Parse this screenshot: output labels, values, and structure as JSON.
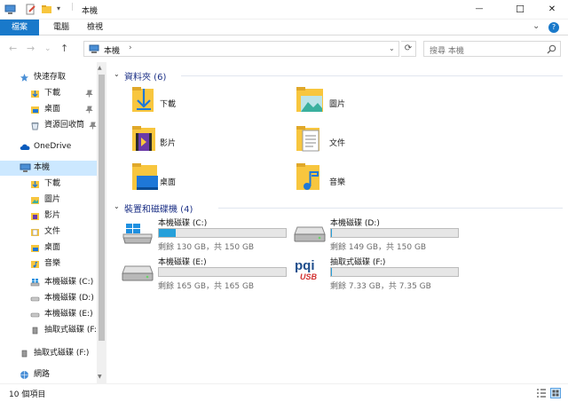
{
  "window": {
    "title": "本機",
    "minimize_glyph": "—",
    "maximize_glyph": "☐",
    "close_glyph": "✕"
  },
  "ribbon": {
    "tabs": [
      "檔案",
      "電腦",
      "檢視"
    ],
    "expand_glyph": "⌄",
    "help_glyph": "?"
  },
  "address": {
    "path": "本機",
    "separator": "›",
    "search_placeholder": "搜尋 本機",
    "nav_back": "←",
    "nav_forward": "→",
    "nav_recent": "⌄",
    "nav_up": "↑",
    "dropdown_glyph": "⌄",
    "refresh_glyph": "⟳"
  },
  "sidebar": {
    "quick_access": "快速存取",
    "quick_items": [
      "下載",
      "桌面",
      "資源回收筒"
    ],
    "onedrive": "OneDrive",
    "this_pc": "本機",
    "pc_items": [
      "下載",
      "圖片",
      "影片",
      "文件",
      "桌面",
      "音樂",
      "本機磁碟 (C:)",
      "本機磁碟 (D:)",
      "本機磁碟 (E:)",
      "抽取式磁碟 (F:)"
    ],
    "removable": "抽取式磁碟 (F:)",
    "network": "網路",
    "scroll_up": "▲",
    "scroll_down": "▼"
  },
  "folders_group": {
    "title": "資料夾 (6)",
    "chevron": "⌄",
    "items": [
      "下載",
      "圖片",
      "影片",
      "文件",
      "桌面",
      "音樂"
    ]
  },
  "drives_group": {
    "title": "裝置和磁碟機 (4)",
    "chevron": "⌄",
    "drives": [
      {
        "name": "本機磁碟 (C:)",
        "free": "剩餘 130 GB，共 150 GB",
        "used_fraction": 0.133
      },
      {
        "name": "本機磁碟 (D:)",
        "free": "剩餘 149 GB，共 150 GB",
        "used_fraction": 0.007
      },
      {
        "name": "本機磁碟 (E:)",
        "free": "剩餘 165 GB，共 165 GB",
        "used_fraction": 0
      },
      {
        "name": "抽取式磁碟 (F:)",
        "free": "剩餘 7.33 GB，共 7.35 GB",
        "used_fraction": 0.003
      }
    ],
    "usb_logo_top": "pqi",
    "usb_logo_bottom": "USB"
  },
  "status": {
    "item_count": "10 個項目"
  },
  "colors": {
    "accent": "#1979ca",
    "selection": "#cce8ff",
    "drive_fill": "#26a0da",
    "folder": "#f8c63e",
    "group_header": "#1e3287"
  }
}
